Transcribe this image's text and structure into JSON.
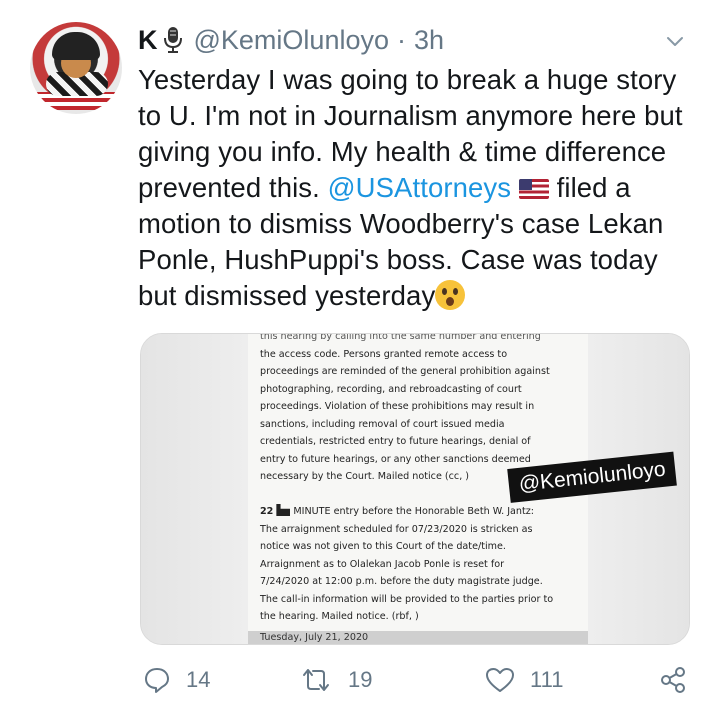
{
  "author": {
    "display_name": "K",
    "handle": "@KemiOlunloyo",
    "separator": "·",
    "time": "3h"
  },
  "tweet": {
    "lines": [
      {
        "text": "Yesterday I was going to break a huge story"
      },
      {
        "text": "to U. I'm not in Journalism anymore here but"
      },
      {
        "text": "giving you info. My health & time difference"
      },
      {
        "pre": "prevented this. ",
        "mention": "@USAttorneys",
        "post": " filed a"
      },
      {
        "text": "motion to dismiss Woodberry's case Lekan"
      },
      {
        "text": "Ponle, HushPuppi's boss. Case was today"
      },
      {
        "text": "but dismissed yesterday"
      }
    ]
  },
  "media": {
    "watermark": "@Kemiolunloyo",
    "doc_lines": [
      "this hearing by calling into the same number and entering",
      "the access code. Persons granted remote access to",
      "proceedings are reminded of the general prohibition against",
      "photographing, recording, and rebroadcasting of court",
      "proceedings. Violation of these prohibitions may result in",
      "sanctions, including removal of court issued media",
      "credentials, restricted entry to future hearings, denial of",
      "entry to future hearings, or any other sanctions deemed",
      "necessary by the Court. Mailed notice (cc, )"
    ],
    "entry_number": "22",
    "entry_first_line": "MINUTE entry before the Honorable Beth W. Jantz:",
    "entry_lines": [
      "The arraignment scheduled for 07/23/2020 is stricken as",
      "notice was not given to this Court of the date/time.",
      "Arraignment as to Olalekan Jacob Ponle is reset for",
      "7/24/2020 at 12:00 p.m. before the duty magistrate judge.",
      "The call-in information will be provided to the parties prior to",
      "the hearing. Mailed notice. (rbf, )"
    ],
    "bottom_text": "Tuesday, July 21, 2020"
  },
  "actions": {
    "reply_count": "14",
    "retweet_count": "19",
    "like_count": "111"
  },
  "colors": {
    "mention": "#1b95e0",
    "secondary_text": "#657786"
  }
}
